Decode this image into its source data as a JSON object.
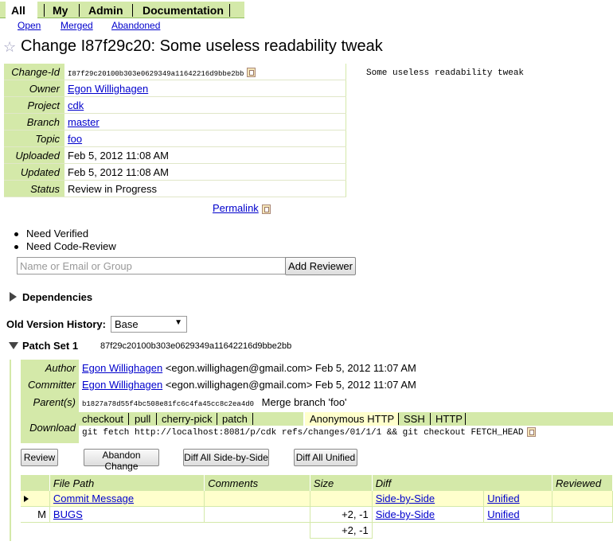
{
  "menu": {
    "top": [
      "All",
      "My",
      "Admin",
      "Documentation"
    ],
    "sub": [
      "Open",
      "Merged",
      "Abandoned"
    ]
  },
  "change": {
    "title": "Change I87f29c20: Some useless readability tweak",
    "star_icon": "star-icon",
    "fields": [
      {
        "label": "Change-Id",
        "value": "I87f29c20100b303e0629349a11642216d9bbe2bb",
        "mono": true,
        "copy": true
      },
      {
        "label": "Owner",
        "value": "Egon Willighagen",
        "link": true
      },
      {
        "label": "Project",
        "value": "cdk",
        "link": true
      },
      {
        "label": "Branch",
        "value": "master",
        "link": true
      },
      {
        "label": "Topic",
        "value": "foo",
        "link": true
      },
      {
        "label": "Uploaded",
        "value": "Feb 5, 2012 11:08 AM"
      },
      {
        "label": "Updated",
        "value": "Feb 5, 2012 11:08 AM"
      },
      {
        "label": "Status",
        "value": "Review in Progress"
      }
    ],
    "commit_message": "Some useless readability tweak",
    "permalink_label": "Permalink"
  },
  "reviewers": {
    "needs": [
      "Need Verified",
      "Need Code-Review"
    ],
    "input_placeholder": "Name or Email or Group",
    "add_button": "Add Reviewer"
  },
  "dependencies_label": "Dependencies",
  "old_version": {
    "label": "Old Version History:",
    "selected": "Base"
  },
  "patch_set": {
    "title": "Patch Set 1",
    "commit": "87f29c20100b303e0629349a11642216d9bbe2bb",
    "author_label": "Author",
    "author_name": "Egon Willighagen",
    "author_email": "<egon.willighagen@gmail.com>",
    "author_date": "Feb 5, 2012 11:07 AM",
    "committer_label": "Committer",
    "committer_name": "Egon Willighagen",
    "committer_email": "<egon.willighagen@gmail.com>",
    "committer_date": "Feb 5, 2012 11:07 AM",
    "parents_label": "Parent(s)",
    "parent_hash": "b1827a78d55f4bc508e81fc6c4fa45cc8c2ea4d0",
    "parent_msg": "Merge branch 'foo'",
    "download_label": "Download",
    "download_types": [
      "checkout",
      "pull",
      "cherry-pick",
      "patch"
    ],
    "download_protocols": [
      "Anonymous HTTP",
      "SSH",
      "HTTP"
    ],
    "download_command": "git fetch http://localhost:8081/p/cdk refs/changes/01/1/1 && git checkout FETCH_HEAD"
  },
  "actions": [
    "Review",
    "Abandon Change",
    "Diff All Side-by-Side",
    "Diff All Unified"
  ],
  "files": {
    "columns": [
      "File Path",
      "Comments",
      "Size",
      "Diff",
      "Reviewed"
    ],
    "rows": [
      {
        "status": "",
        "path": "Commit Message",
        "comments": "",
        "size": "",
        "sbs": "Side-by-Side",
        "unified": "Unified"
      },
      {
        "status": "M",
        "path": "BUGS",
        "comments": "",
        "size": "+2, -1",
        "sbs": "Side-by-Side",
        "unified": "Unified"
      }
    ],
    "total_size": "+2, -1"
  },
  "colors": {
    "accent": "#d4e9a9",
    "link": "#0000cc",
    "highlight": "#ffffcc"
  }
}
